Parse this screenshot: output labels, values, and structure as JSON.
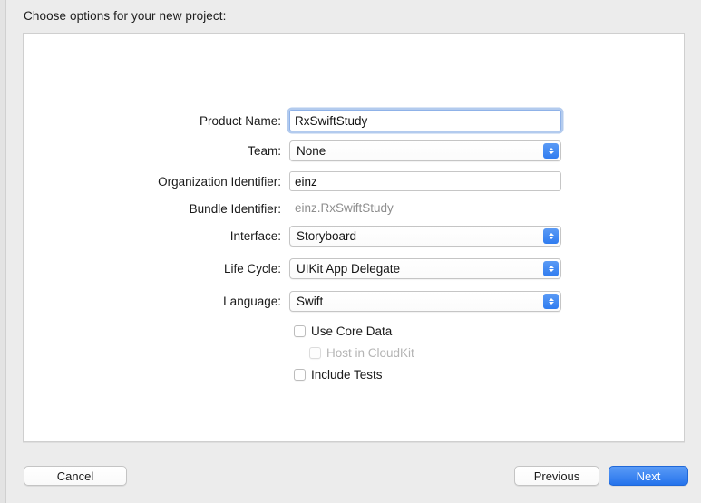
{
  "dialog": {
    "title": "Choose options for your new project:"
  },
  "form": {
    "rows": [
      {
        "label": "Product Name:",
        "value": "RxSwiftStudy",
        "type": "textfield-focused"
      },
      {
        "label": "Team:",
        "value": "None",
        "type": "popup"
      },
      {
        "label": "Organization Identifier:",
        "value": "einz",
        "type": "textfield"
      },
      {
        "label": "Bundle Identifier:",
        "value": "einz.RxSwiftStudy",
        "type": "static"
      },
      {
        "label": "Interface:",
        "value": "Storyboard",
        "type": "popup"
      },
      {
        "label": "Life Cycle:",
        "value": "UIKit App Delegate",
        "type": "popup"
      },
      {
        "label": "Language:",
        "value": "Swift",
        "type": "popup"
      }
    ]
  },
  "checkboxes": [
    {
      "label": "Use Core Data",
      "checked": false,
      "disabled": false
    },
    {
      "label": "Host in CloudKit",
      "checked": false,
      "disabled": true
    },
    {
      "label": "Include Tests",
      "checked": false,
      "disabled": false
    }
  ],
  "buttons": {
    "cancel": "Cancel",
    "previous": "Previous",
    "next": "Next"
  },
  "colors": {
    "accent_blue": "#2573ec",
    "stepper_blue": "#2f7cf0",
    "focus_ring": "#b3cbee",
    "disabled_text": "#b4b4b4",
    "static_text": "#8e8e8e",
    "window_bg": "#ececec",
    "panel_bg": "#ffffff"
  }
}
